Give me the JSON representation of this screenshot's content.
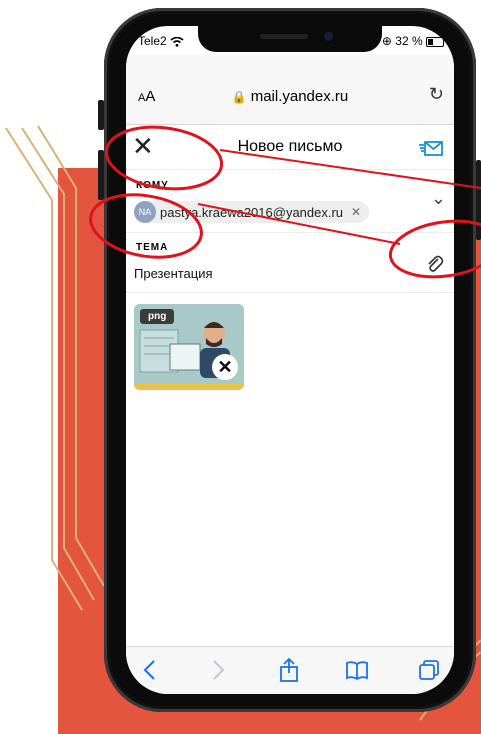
{
  "status": {
    "carrier": "Tele2",
    "battery": "32 %"
  },
  "browser": {
    "text_size_label": "AA",
    "url": "mail.yandex.ru",
    "icons": [
      "lock-icon",
      "reload-icon"
    ]
  },
  "compose": {
    "title": "Новое письмо",
    "to_label": "КОМУ",
    "recipient": {
      "initials": "NA",
      "email": "pastya.kraewa2016@yandex.ru"
    },
    "subject_label": "ТЕМА",
    "subject_value": "Презентация",
    "attachment": {
      "badge": "png"
    }
  },
  "toolbar": {
    "icons": [
      "back-icon",
      "forward-icon",
      "share-icon",
      "bookmarks-icon",
      "tabs-icon"
    ]
  },
  "colors": {
    "background_accent": "#e4553f",
    "annotation": "#e0121c",
    "mail_accent": "#1a8fd6"
  }
}
